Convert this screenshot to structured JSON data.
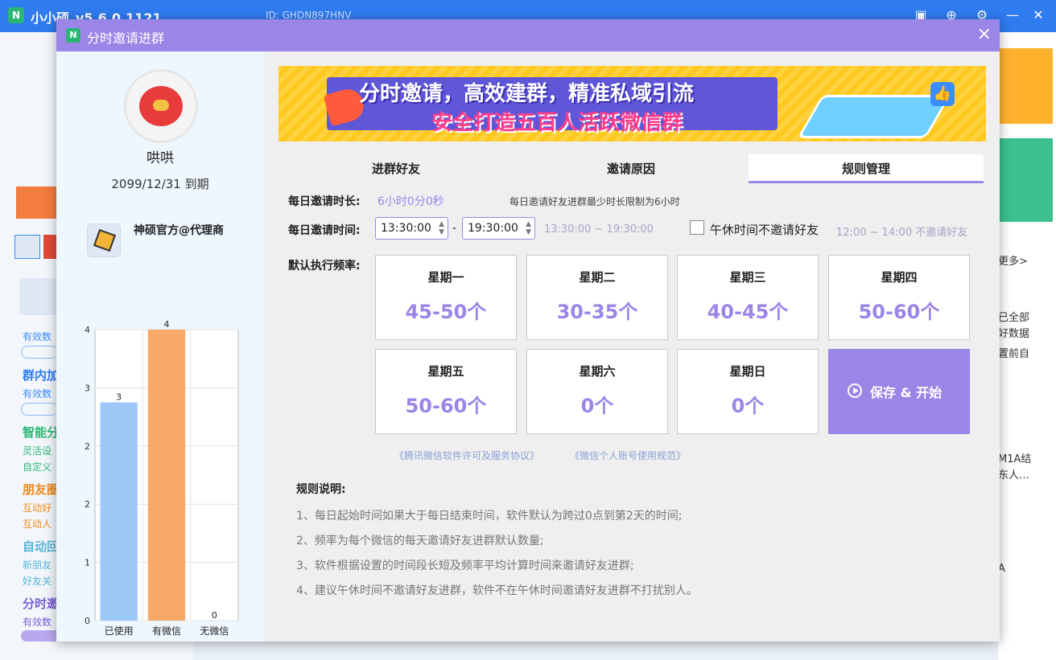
{
  "bg_app": {
    "title": "小小硕_v5.6.0.1121",
    "id_text": "ID: GHDN897HNV",
    "left_fragments": [
      "有效数",
      "群内加",
      "有效数",
      "智能分",
      "灵活设",
      "自定义",
      "朋友圈",
      "互动好",
      "互动人",
      "自动回",
      "新朋友",
      "好友关",
      "分时邀",
      "有效数"
    ],
    "right_fragments": [
      "更多>",
      "已全部",
      "好数据",
      "置前自",
      "M1A结",
      "东人…",
      "A"
    ]
  },
  "dialog": {
    "title": "分时邀请进群",
    "close": "×",
    "icon_letter": "N"
  },
  "user": {
    "name": "哄哄",
    "expiry": "2099/12/31 到期",
    "agent": "神硕官方@代理商"
  },
  "banner": {
    "line1": "分时邀请，高效建群，精准私域引流",
    "line2": "安全打造五百人活跃微信群"
  },
  "tabs": [
    {
      "label": "进群好友",
      "active": false
    },
    {
      "label": "邀请原因",
      "active": false
    },
    {
      "label": "规则管理",
      "active": true
    }
  ],
  "settings": {
    "duration_label": "每日邀请时长:",
    "duration_value": "6小时0分0秒",
    "duration_note": "每日邀请好友进群最少时长限制为6小时",
    "time_label": "每日邀请时间:",
    "start_time": "13:30:00",
    "dash": "-",
    "end_time": "19:30:00",
    "time_range_hint": "13:30:00 ~ 19:30:00",
    "noon_checkbox_label": "午休时间不邀请好友",
    "noon_checked": false,
    "noon_hint": "12:00 ~ 14:00 不邀请好友",
    "freq_label": "默认执行频率:"
  },
  "days": [
    {
      "name": "星期一",
      "value": "45-50个"
    },
    {
      "name": "星期二",
      "value": "30-35个"
    },
    {
      "name": "星期三",
      "value": "40-45个"
    },
    {
      "name": "星期四",
      "value": "50-60个"
    },
    {
      "name": "星期五",
      "value": "50-60个"
    },
    {
      "name": "星期六",
      "value": "0个"
    },
    {
      "name": "星期日",
      "value": "0个"
    }
  ],
  "save_button": "保存 & 开始",
  "links": [
    "《腾讯微信软件许可及服务协议》",
    "《微信个人账号使用规范》"
  ],
  "rules": {
    "title": "规则说明:",
    "items": [
      "1、每日起始时间如果大于每日结束时间，软件默认为跨过0点到第2天的时间;",
      "2、频率为每个微信的每天邀请好友进群默认数量;",
      "3、软件根据设置的时间段长短及频率平均计算时间来邀请好友进群;",
      "4、建议午休时间不邀请好友进群，软件不在午休时间邀请好友进群不打扰别人。"
    ]
  },
  "chart_data": {
    "type": "bar",
    "categories": [
      "已使用",
      "有微信",
      "无微信"
    ],
    "values": [
      3,
      4,
      0
    ],
    "colors": [
      "#9cc8f7",
      "#f7a96a",
      "#cccccc"
    ],
    "ylim": [
      0,
      4
    ],
    "yticks": [
      0,
      1,
      2,
      2,
      3,
      4
    ],
    "grid": true
  }
}
